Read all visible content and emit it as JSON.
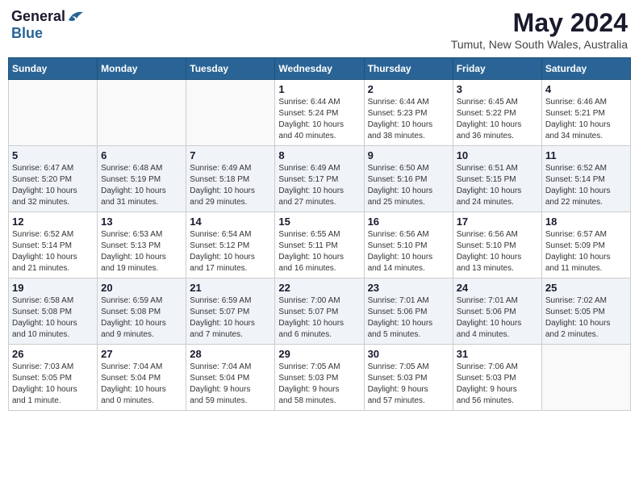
{
  "logo": {
    "general": "General",
    "blue": "Blue"
  },
  "title": {
    "month_year": "May 2024",
    "location": "Tumut, New South Wales, Australia"
  },
  "weekdays": [
    "Sunday",
    "Monday",
    "Tuesday",
    "Wednesday",
    "Thursday",
    "Friday",
    "Saturday"
  ],
  "weeks": [
    {
      "days": [
        {
          "date": "",
          "info": ""
        },
        {
          "date": "",
          "info": ""
        },
        {
          "date": "",
          "info": ""
        },
        {
          "date": "1",
          "info": "Sunrise: 6:44 AM\nSunset: 5:24 PM\nDaylight: 10 hours\nand 40 minutes."
        },
        {
          "date": "2",
          "info": "Sunrise: 6:44 AM\nSunset: 5:23 PM\nDaylight: 10 hours\nand 38 minutes."
        },
        {
          "date": "3",
          "info": "Sunrise: 6:45 AM\nSunset: 5:22 PM\nDaylight: 10 hours\nand 36 minutes."
        },
        {
          "date": "4",
          "info": "Sunrise: 6:46 AM\nSunset: 5:21 PM\nDaylight: 10 hours\nand 34 minutes."
        }
      ]
    },
    {
      "days": [
        {
          "date": "5",
          "info": "Sunrise: 6:47 AM\nSunset: 5:20 PM\nDaylight: 10 hours\nand 32 minutes."
        },
        {
          "date": "6",
          "info": "Sunrise: 6:48 AM\nSunset: 5:19 PM\nDaylight: 10 hours\nand 31 minutes."
        },
        {
          "date": "7",
          "info": "Sunrise: 6:49 AM\nSunset: 5:18 PM\nDaylight: 10 hours\nand 29 minutes."
        },
        {
          "date": "8",
          "info": "Sunrise: 6:49 AM\nSunset: 5:17 PM\nDaylight: 10 hours\nand 27 minutes."
        },
        {
          "date": "9",
          "info": "Sunrise: 6:50 AM\nSunset: 5:16 PM\nDaylight: 10 hours\nand 25 minutes."
        },
        {
          "date": "10",
          "info": "Sunrise: 6:51 AM\nSunset: 5:15 PM\nDaylight: 10 hours\nand 24 minutes."
        },
        {
          "date": "11",
          "info": "Sunrise: 6:52 AM\nSunset: 5:14 PM\nDaylight: 10 hours\nand 22 minutes."
        }
      ]
    },
    {
      "days": [
        {
          "date": "12",
          "info": "Sunrise: 6:52 AM\nSunset: 5:14 PM\nDaylight: 10 hours\nand 21 minutes."
        },
        {
          "date": "13",
          "info": "Sunrise: 6:53 AM\nSunset: 5:13 PM\nDaylight: 10 hours\nand 19 minutes."
        },
        {
          "date": "14",
          "info": "Sunrise: 6:54 AM\nSunset: 5:12 PM\nDaylight: 10 hours\nand 17 minutes."
        },
        {
          "date": "15",
          "info": "Sunrise: 6:55 AM\nSunset: 5:11 PM\nDaylight: 10 hours\nand 16 minutes."
        },
        {
          "date": "16",
          "info": "Sunrise: 6:56 AM\nSunset: 5:10 PM\nDaylight: 10 hours\nand 14 minutes."
        },
        {
          "date": "17",
          "info": "Sunrise: 6:56 AM\nSunset: 5:10 PM\nDaylight: 10 hours\nand 13 minutes."
        },
        {
          "date": "18",
          "info": "Sunrise: 6:57 AM\nSunset: 5:09 PM\nDaylight: 10 hours\nand 11 minutes."
        }
      ]
    },
    {
      "days": [
        {
          "date": "19",
          "info": "Sunrise: 6:58 AM\nSunset: 5:08 PM\nDaylight: 10 hours\nand 10 minutes."
        },
        {
          "date": "20",
          "info": "Sunrise: 6:59 AM\nSunset: 5:08 PM\nDaylight: 10 hours\nand 9 minutes."
        },
        {
          "date": "21",
          "info": "Sunrise: 6:59 AM\nSunset: 5:07 PM\nDaylight: 10 hours\nand 7 minutes."
        },
        {
          "date": "22",
          "info": "Sunrise: 7:00 AM\nSunset: 5:07 PM\nDaylight: 10 hours\nand 6 minutes."
        },
        {
          "date": "23",
          "info": "Sunrise: 7:01 AM\nSunset: 5:06 PM\nDaylight: 10 hours\nand 5 minutes."
        },
        {
          "date": "24",
          "info": "Sunrise: 7:01 AM\nSunset: 5:06 PM\nDaylight: 10 hours\nand 4 minutes."
        },
        {
          "date": "25",
          "info": "Sunrise: 7:02 AM\nSunset: 5:05 PM\nDaylight: 10 hours\nand 2 minutes."
        }
      ]
    },
    {
      "days": [
        {
          "date": "26",
          "info": "Sunrise: 7:03 AM\nSunset: 5:05 PM\nDaylight: 10 hours\nand 1 minute."
        },
        {
          "date": "27",
          "info": "Sunrise: 7:04 AM\nSunset: 5:04 PM\nDaylight: 10 hours\nand 0 minutes."
        },
        {
          "date": "28",
          "info": "Sunrise: 7:04 AM\nSunset: 5:04 PM\nDaylight: 9 hours\nand 59 minutes."
        },
        {
          "date": "29",
          "info": "Sunrise: 7:05 AM\nSunset: 5:03 PM\nDaylight: 9 hours\nand 58 minutes."
        },
        {
          "date": "30",
          "info": "Sunrise: 7:05 AM\nSunset: 5:03 PM\nDaylight: 9 hours\nand 57 minutes."
        },
        {
          "date": "31",
          "info": "Sunrise: 7:06 AM\nSunset: 5:03 PM\nDaylight: 9 hours\nand 56 minutes."
        },
        {
          "date": "",
          "info": ""
        }
      ]
    }
  ]
}
